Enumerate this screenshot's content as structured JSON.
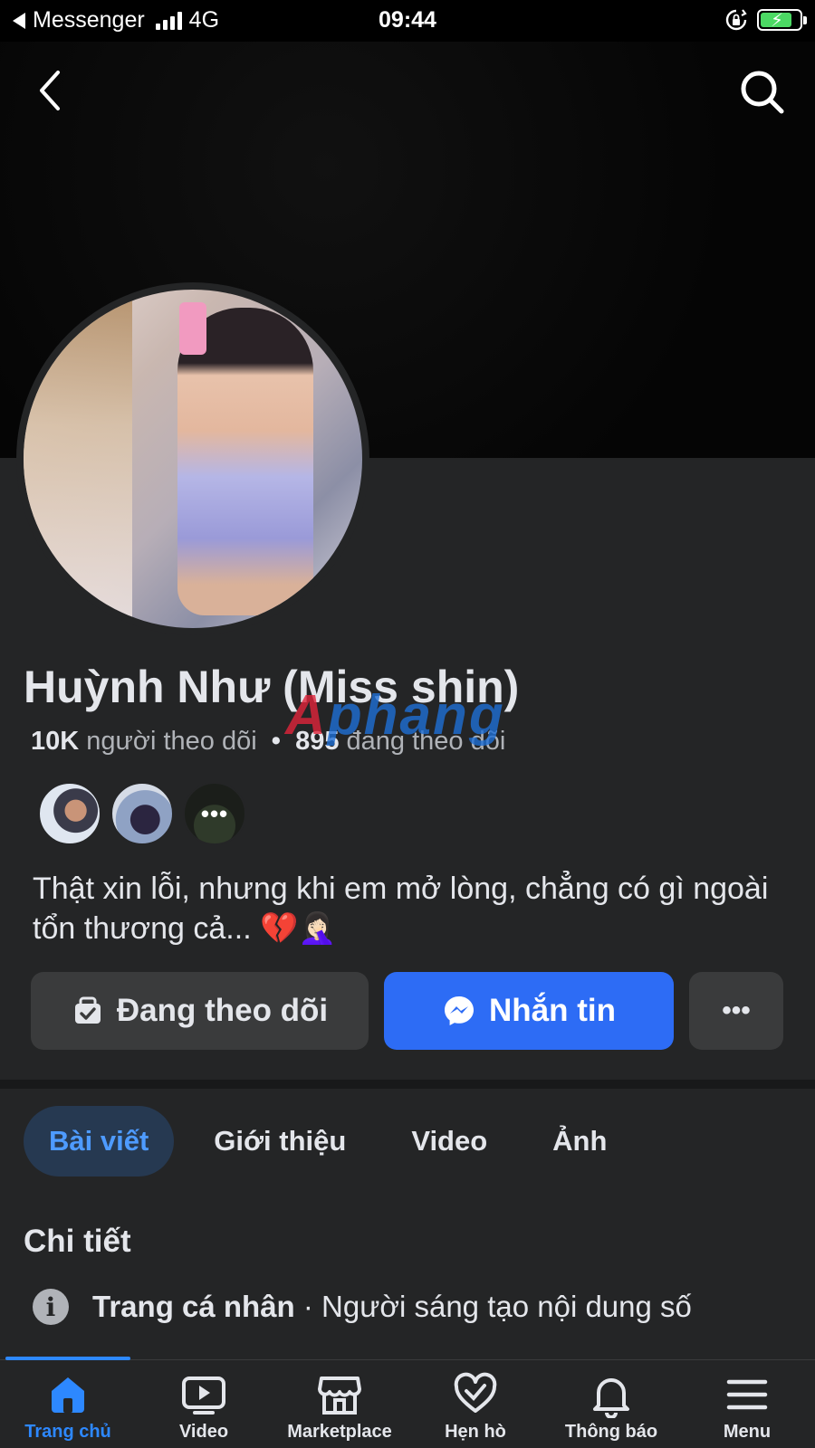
{
  "status_bar": {
    "back_app": "Messenger",
    "network": "4G",
    "time": "09:44"
  },
  "profile": {
    "name": "Huỳnh Như (Miss shin)",
    "followers_count": "10K",
    "followers_label": "người theo dõi",
    "following_count": "895",
    "following_label": "đang theo dõi",
    "separator": "•",
    "friends_more": "•••",
    "bio": "Thật xin lỗi, nhưng khi em mở lòng, chẳng có gì ngoài tổn thương cả... 💔🤦🏻‍♀️"
  },
  "watermark": {
    "a": "A",
    "rest": "phang"
  },
  "actions": {
    "following_label": "Đang theo dõi",
    "message_label": "Nhắn tin",
    "more_label": "•••",
    "message_color": "#2d6cf5"
  },
  "tabs": [
    {
      "label": "Bài viết",
      "active": true
    },
    {
      "label": "Giới thiệu",
      "active": false
    },
    {
      "label": "Video",
      "active": false
    },
    {
      "label": "Ảnh",
      "active": false
    }
  ],
  "details": {
    "title": "Chi tiết",
    "info_icon_glyph": "i",
    "row_bold": "Trang cá nhân",
    "row_rest": " · Người sáng tạo nội dung số"
  },
  "bottom_nav": [
    {
      "label": "Trang chủ",
      "icon": "home-icon",
      "active": true
    },
    {
      "label": "Video",
      "icon": "video-icon",
      "active": false
    },
    {
      "label": "Marketplace",
      "icon": "marketplace-icon",
      "active": false
    },
    {
      "label": "Hẹn hò",
      "icon": "dating-heart-icon",
      "active": false
    },
    {
      "label": "Thông báo",
      "icon": "bell-icon",
      "active": false
    },
    {
      "label": "Menu",
      "icon": "menu-icon",
      "active": false
    }
  ],
  "colors": {
    "accent": "#2d88ff",
    "background": "#242526",
    "battery": "#4cd964"
  }
}
